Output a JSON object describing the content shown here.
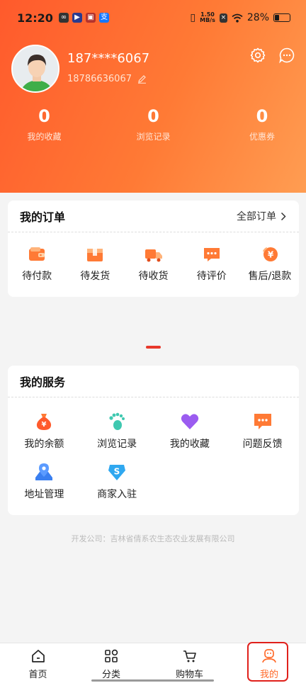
{
  "status_bar": {
    "time": "12:20",
    "net_speed_top": "1.50",
    "net_speed_unit": "MB/s",
    "battery": "28%"
  },
  "profile": {
    "username": "187****6067",
    "phone": "18786636067"
  },
  "stats": [
    {
      "value": "0",
      "label": "我的收藏"
    },
    {
      "value": "0",
      "label": "浏览记录"
    },
    {
      "value": "0",
      "label": "优惠券"
    }
  ],
  "orders": {
    "title": "我的订单",
    "all_label": "全部订单",
    "items": [
      {
        "label": "待付款",
        "icon": "wallet-icon"
      },
      {
        "label": "待发货",
        "icon": "package-icon"
      },
      {
        "label": "待收货",
        "icon": "truck-icon"
      },
      {
        "label": "待评价",
        "icon": "comment-icon"
      },
      {
        "label": "售后/退款",
        "icon": "refund-icon"
      }
    ]
  },
  "services": {
    "title": "我的服务",
    "items": [
      {
        "label": "我的余额",
        "icon": "money-bag-icon"
      },
      {
        "label": "浏览记录",
        "icon": "footprint-icon"
      },
      {
        "label": "我的收藏",
        "icon": "heart-icon"
      },
      {
        "label": "问题反馈",
        "icon": "feedback-icon"
      },
      {
        "label": "地址管理",
        "icon": "map-pin-icon"
      },
      {
        "label": "商家入驻",
        "icon": "merchant-icon"
      }
    ]
  },
  "footer": {
    "company": "开发公司：吉林省倩系农生态农业发展有限公司"
  },
  "tabbar": {
    "items": [
      {
        "label": "首页",
        "icon": "home-icon"
      },
      {
        "label": "分类",
        "icon": "category-icon"
      },
      {
        "label": "购物车",
        "icon": "cart-icon"
      },
      {
        "label": "我的",
        "icon": "user-icon",
        "active": true
      }
    ]
  },
  "colors": {
    "accent": "#ff6a2a",
    "header_start": "#ff5a2c",
    "header_end": "#ff9d52",
    "highlight": "#e0201b"
  }
}
